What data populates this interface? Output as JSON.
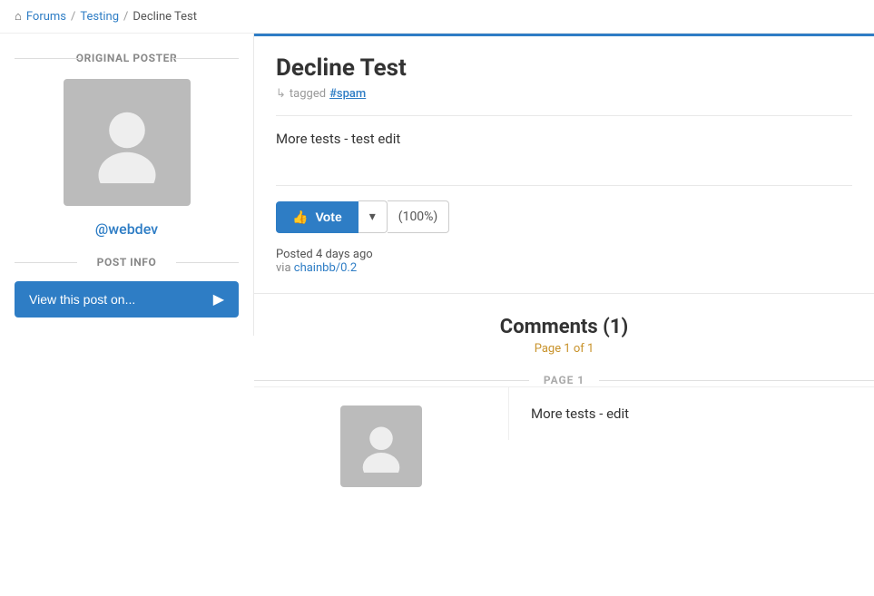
{
  "breadcrumb": {
    "home_icon": "⌂",
    "home_label": "Forums",
    "sep1": "/",
    "section": "Testing",
    "sep2": "/",
    "page": "Decline Test"
  },
  "sidebar": {
    "original_poster_label": "ORIGINAL POSTER",
    "username": "@webdev",
    "post_info_label": "POST INFO",
    "view_post_btn": "View this post on...",
    "arrow": "▶"
  },
  "post": {
    "title": "Decline Test",
    "tagged_arrow": "↳",
    "tagged_label": "tagged",
    "tag": "#spam",
    "body": "More tests - test edit",
    "vote_btn": "Vote",
    "vote_percent": "(100%)",
    "posted_text": "Posted 4 days ago",
    "via_label": "via",
    "via_link": "chainbb/0.2"
  },
  "comments": {
    "title": "Comments (1)",
    "page_info": "Page 1 of 1",
    "page_label": "PAGE 1",
    "items": [
      {
        "body": "More tests - edit"
      }
    ]
  }
}
